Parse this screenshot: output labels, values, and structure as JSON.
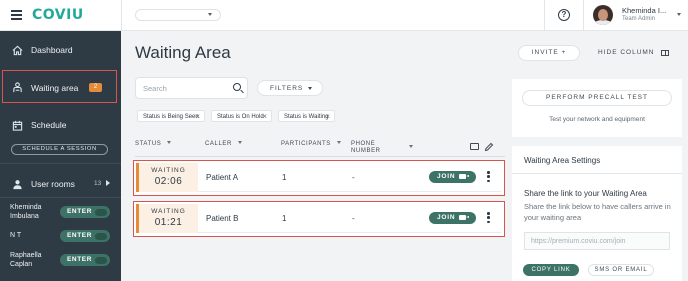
{
  "brand": {
    "logo": "COVIU",
    "accent": "#21a99a"
  },
  "header": {
    "org_select": "",
    "help_icon": "question-circle-icon",
    "user": {
      "name": "Kheminda I...",
      "role": "Team Admin"
    }
  },
  "sidebar": {
    "dashboard": "Dashboard",
    "waiting_area": {
      "label": "Waiting area",
      "count": "2"
    },
    "schedule": "Schedule",
    "schedule_session": "SCHEDULE A SESSION",
    "user_rooms": {
      "label": "User rooms",
      "count": "13"
    },
    "rooms": [
      {
        "name": "Kheminda Imbulana",
        "action": "ENTER"
      },
      {
        "name": "N T",
        "action": "ENTER"
      },
      {
        "name": "Raphaella Caplan",
        "action": "ENTER"
      }
    ]
  },
  "main": {
    "title": "Waiting Area",
    "invite": "INVITE +",
    "hide_column": "HIDE COLUMN",
    "search_placeholder": "Search",
    "filters": "FILTERS",
    "chips": [
      "Status is Being Seen",
      "Status is On Hold",
      "Status is Waiting"
    ],
    "columns": {
      "status": "STATUS",
      "caller": "CALLER",
      "participants": "PARTICIPANTS",
      "phone_1": "PHONE",
      "phone_2": "NUMBER"
    },
    "rows": [
      {
        "status": "WAITING",
        "time": "02:06",
        "caller": "Patient A",
        "participants": "1",
        "phone": "-",
        "action": "JOIN"
      },
      {
        "status": "WAITING",
        "time": "01:21",
        "caller": "Patient B",
        "participants": "1",
        "phone": "-",
        "action": "JOIN"
      }
    ]
  },
  "precall": {
    "button": "PERFORM PRECALL TEST",
    "subtitle": "Test your network and equipment"
  },
  "settings": {
    "title": "Waiting Area Settings",
    "share_heading": "Share the link to your Waiting Area",
    "share_desc": "Share the link below to have callers arrive in your waiting area",
    "link_placeholder": "https://premium.coviu.com/join",
    "copy_link": "COPY LINK",
    "sms_email": "SMS OR EMAIL"
  },
  "colors": {
    "sidebar_bg": "#2e3a44",
    "waiting_accent": "#e58b3a",
    "action_green": "#3d7266",
    "highlight_red": "#d9534f"
  }
}
